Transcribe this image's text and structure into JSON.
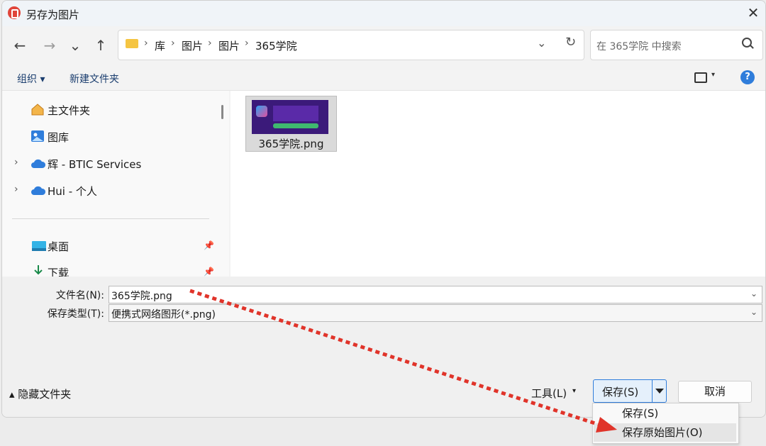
{
  "window": {
    "title": "另存为图片",
    "close_symbol": "✕"
  },
  "nav": {
    "back": "←",
    "forward": "→",
    "recent": "⌄",
    "up": "↑",
    "breadcrumb": [
      "库",
      "图片",
      "图片",
      "365学院"
    ],
    "separator": "›",
    "dropdown": "⌄",
    "refresh": "↻",
    "search_placeholder": "在 365学院 中搜索"
  },
  "commands": {
    "organize": "组织 ▾",
    "new_folder": "新建文件夹",
    "help": "?",
    "view_chev": "▾"
  },
  "sidebar": {
    "items": [
      {
        "label": "主文件夹",
        "icon": "home-icon"
      },
      {
        "label": "图库",
        "icon": "gallery-icon"
      },
      {
        "label": "辉 - BTIC Services",
        "icon": "cloud-icon",
        "expandable": true
      },
      {
        "label": "Hui - 个人",
        "icon": "cloud-icon",
        "expandable": true
      },
      {
        "label": "桌面",
        "icon": "desktop-icon",
        "pinned": true
      },
      {
        "label": "下载",
        "icon": "download-icon",
        "pinned": true
      }
    ],
    "expand_symbol": "›",
    "pin_symbol": "📌"
  },
  "files": [
    {
      "name": "365学院.png",
      "type": "png-thumbnail"
    }
  ],
  "form": {
    "filename_label": "文件名(N):",
    "filename_value": "365学院.png",
    "filetype_label": "保存类型(T):",
    "filetype_value": "便携式网络图形(*.png)",
    "chev": "⌄"
  },
  "footer": {
    "hide_folders": "▴ 隐藏文件夹",
    "tools": "工具(L)",
    "tools_chev": "▾",
    "save": "保存(S)",
    "cancel": "取消"
  },
  "save_menu": {
    "items": [
      "保存(S)",
      "保存原始图片(O)"
    ],
    "highlighted_index": 1
  },
  "colors": {
    "accent": "#2f7ddb",
    "arrow": "#e0342a"
  }
}
